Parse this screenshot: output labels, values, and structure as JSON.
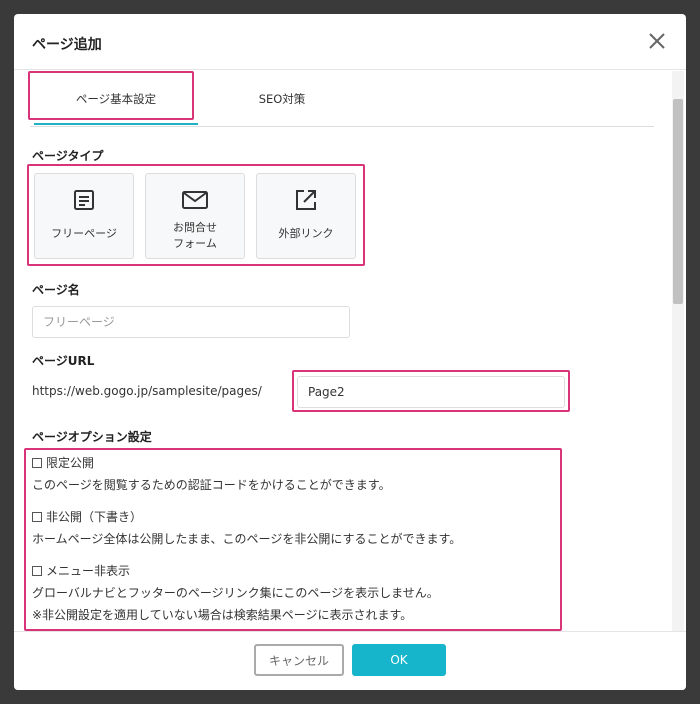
{
  "modal": {
    "title": "ページ追加"
  },
  "tabs": [
    {
      "label": "ページ基本設定",
      "active": true
    },
    {
      "label": "SEO対策",
      "active": false
    }
  ],
  "page_type": {
    "label": "ページタイプ",
    "cards": [
      {
        "icon": "document-icon",
        "line1": "フリーページ",
        "line2": ""
      },
      {
        "icon": "mail-icon",
        "line1": "お問合せ",
        "line2": "フォーム"
      },
      {
        "icon": "external-link-icon",
        "line1": "外部リンク",
        "line2": ""
      }
    ]
  },
  "page_name": {
    "label": "ページ名",
    "placeholder": "フリーページ"
  },
  "page_url": {
    "label": "ページURL",
    "prefix": "https://web.gogo.jp/samplesite/pages/",
    "value": "Page2"
  },
  "options": {
    "label": "ページオプション設定",
    "items": [
      {
        "check": "限定公開",
        "desc1": "このページを閲覧するための認証コードをかけることができます。",
        "desc2": ""
      },
      {
        "check": "非公開（下書き）",
        "desc1": "ホームページ全体は公開したまま、このページを非公開にすることができます。",
        "desc2": ""
      },
      {
        "check": "メニュー非表示",
        "desc1": "グローバルナビとフッターのページリンク集にこのページを表示しません。",
        "desc2": "※非公開設定を適用していない場合は検索結果ページに表示されます。"
      }
    ]
  },
  "footer": {
    "cancel_label": "キャンセル",
    "ok_label": "OK"
  },
  "colors": {
    "accent": "#16b5cc",
    "highlight": "#d9337a"
  }
}
